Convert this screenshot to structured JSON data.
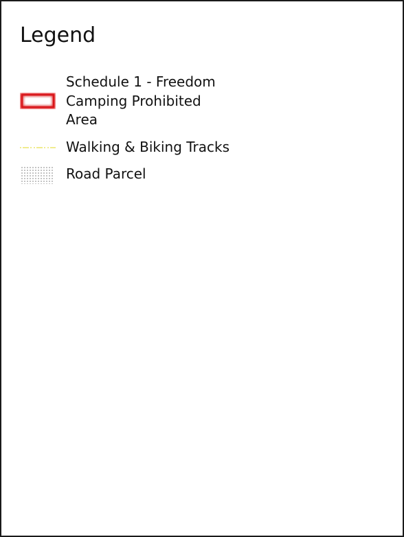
{
  "legend": {
    "title": "Legend",
    "items": [
      {
        "label_lines": [
          "Schedule 1 - Freedom",
          "Camping Prohibited",
          "Area"
        ],
        "symbol": "red-outlined-area-swatch",
        "color": "#e02020"
      },
      {
        "label_lines": [
          "Walking & Biking Tracks"
        ],
        "symbol": "dashed-yellow-line",
        "color": "#e6df3a"
      },
      {
        "label_lines": [
          "Road Parcel"
        ],
        "symbol": "dotted-grey-area-swatch",
        "color": "#7a7a7a"
      }
    ]
  }
}
